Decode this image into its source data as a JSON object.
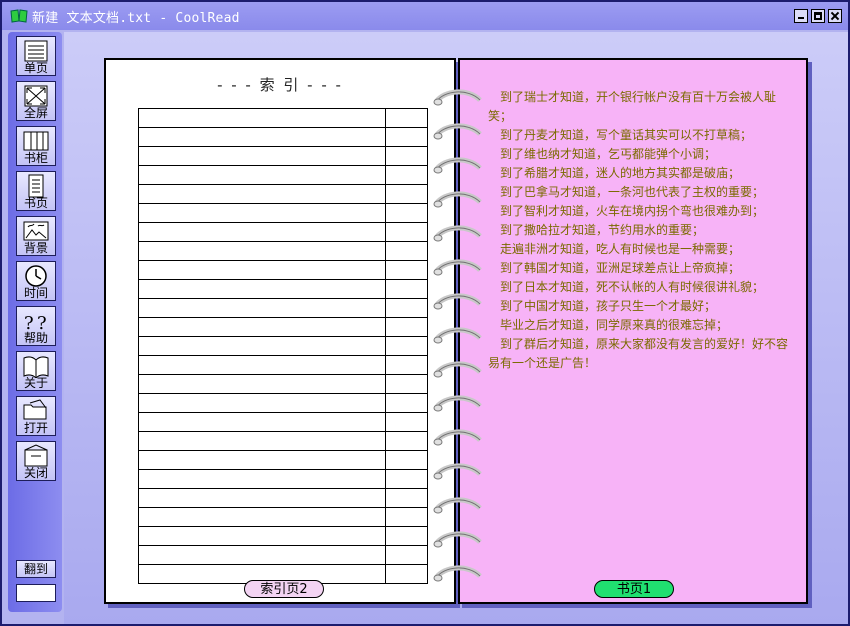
{
  "window": {
    "title": "新建 文本文档.txt - CoolRead"
  },
  "sidebar": {
    "tools": [
      {
        "id": "single-page",
        "label": "单页",
        "icon": "single-page-icon"
      },
      {
        "id": "fullscreen",
        "label": "全屏",
        "icon": "fullscreen-icon"
      },
      {
        "id": "bookshelf",
        "label": "书柜",
        "icon": "bookshelf-icon"
      },
      {
        "id": "book-page",
        "label": "书页",
        "icon": "book-page-icon"
      },
      {
        "id": "background",
        "label": "背景",
        "icon": "background-icon"
      },
      {
        "id": "time",
        "label": "时间",
        "icon": "clock-icon"
      },
      {
        "id": "help",
        "label": "帮助",
        "icon": "help-icon"
      },
      {
        "id": "about",
        "label": "关于",
        "icon": "about-book-icon"
      },
      {
        "id": "open",
        "label": "打开",
        "icon": "open-folder-icon"
      },
      {
        "id": "close",
        "label": "关闭",
        "icon": "close-box-icon"
      }
    ],
    "goto_label": "翻到",
    "goto_value": ""
  },
  "left_page": {
    "title": "- - - 索 引 - - -",
    "rows": 25,
    "button": "索引页2"
  },
  "right_page": {
    "lines": [
      "　到了瑞士才知道，开个银行帐户没有百十万会被人耻笑；",
      "　到了丹麦才知道，写个童话其实可以不打草稿；",
      "　到了维也纳才知道，乞丐都能弹个小调；",
      "　到了希腊才知道，迷人的地方其实都是破庙；",
      "　到了巴拿马才知道，一条河也代表了主权的重要；",
      "　到了智利才知道，火车在境内拐个弯也很难办到；",
      "　到了撒哈拉才知道，节约用水的重要；",
      "　走遍非洲才知道，吃人有时候也是一种需要；",
      "　到了韩国才知道，亚洲足球差点让上帝疯掉；",
      "　到了日本才知道，死不认帐的人有时候很讲礼貌；",
      "　到了中国才知道，孩子只生一个才最好；",
      "　毕业之后才知道，同学原来真的很难忘掉；",
      "　到了群后才知道，原来大家都没有发言的爱好！好不容易有一个还是广告！"
    ],
    "button": "书页1"
  },
  "colors": {
    "accent": "#8a8aeb",
    "page_right": "#f7b3f7",
    "text": "#7b6a00",
    "page_button": "#20e070"
  }
}
